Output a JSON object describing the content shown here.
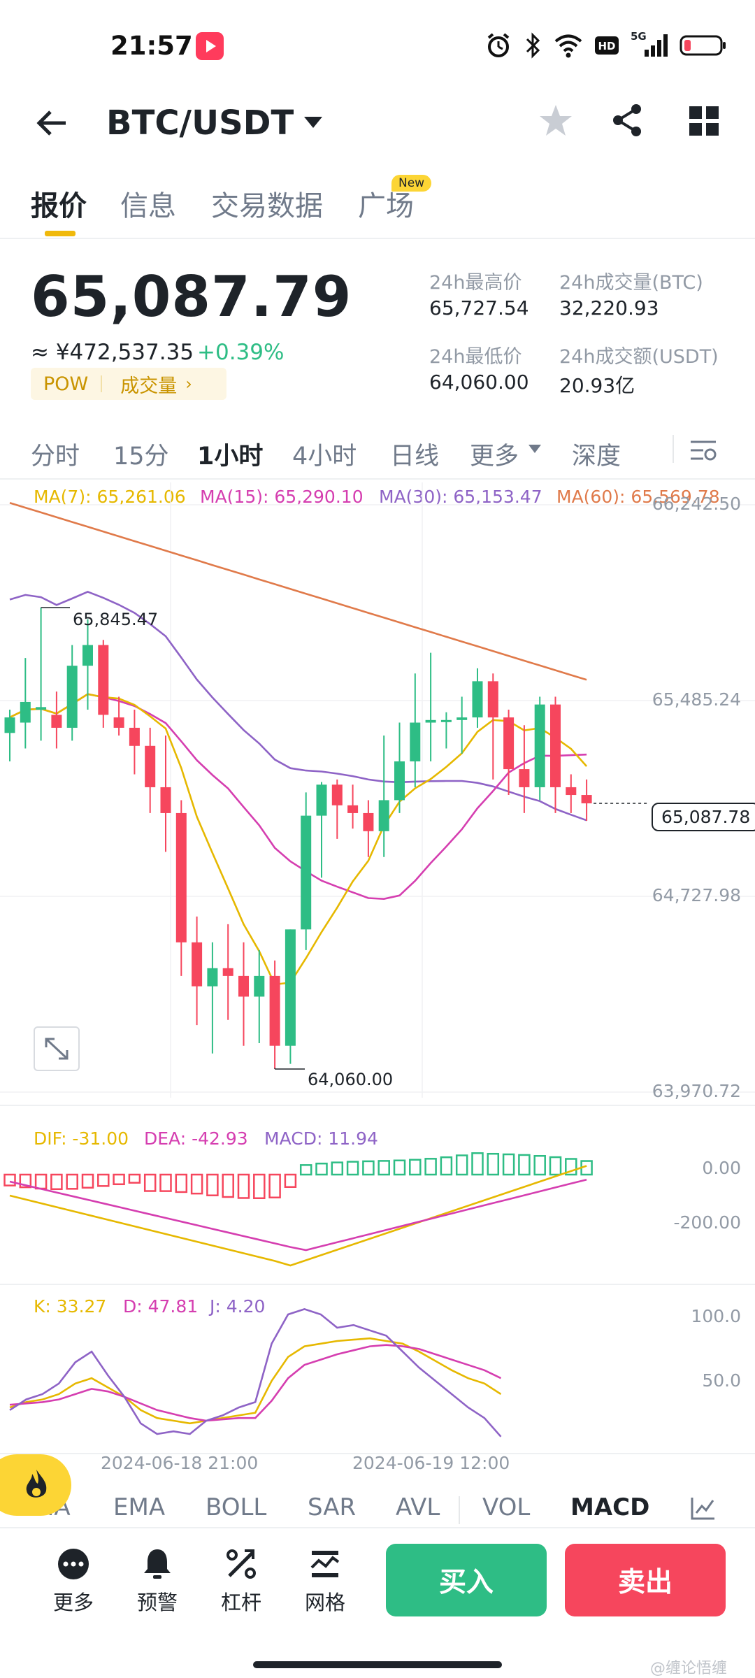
{
  "status_bar": {
    "time": "21:57",
    "network": "5G"
  },
  "header": {
    "pair": "BTC/USDT"
  },
  "tabs": [
    {
      "label": "报价"
    },
    {
      "label": "信息"
    },
    {
      "label": "交易数据"
    },
    {
      "label": "广场",
      "badge": "New"
    }
  ],
  "price": {
    "last": "65,087.79",
    "cny": "≈ ¥472,537.35",
    "change": "+0.39%",
    "tag_pow": "POW",
    "tag_volume": "成交量"
  },
  "stats": {
    "high_label": "24h最高价",
    "high": "65,727.54",
    "low_label": "24h最低价",
    "low": "64,060.00",
    "vol_btc_label": "24h成交量(BTC)",
    "vol_btc": "32,220.93",
    "vol_usdt_label": "24h成交额(USDT)",
    "vol_usdt": "20.93亿"
  },
  "intervals": [
    "分时",
    "15分",
    "1小时",
    "4小时",
    "日线",
    "更多",
    "深度"
  ],
  "ma": {
    "ma7": "MA(7): 65,261.06",
    "ma15": "MA(15): 65,290.10",
    "ma30": "MA(30): 65,153.47",
    "ma60": "MA(60): 65,569.78"
  },
  "price_axis": [
    "66,242.50",
    "65,485.24",
    "64,727.98",
    "63,970.72"
  ],
  "current_price_label": "65,087.78",
  "high_marker": "65,845.47",
  "low_marker": "64,060.00",
  "macd": {
    "dif": "DIF: -31.00",
    "dea": "DEA: -42.93",
    "macd": "MACD: 11.94",
    "axis": [
      "0.00",
      "-200.00"
    ]
  },
  "kdj": {
    "k": "K: 33.27",
    "d": "D: 47.81",
    "j": "J: 4.20",
    "axis": [
      "100.0",
      "50.0"
    ]
  },
  "time_axis": [
    "2024-06-18 21:00",
    "2024-06-19 12:00"
  ],
  "indicators": [
    "MA",
    "EMA",
    "BOLL",
    "SAR",
    "AVL",
    "VOL",
    "MACD"
  ],
  "bottom_bar": {
    "more": "更多",
    "alert": "预警",
    "leverage": "杠杆",
    "grid": "网格",
    "buy": "买入",
    "sell": "卖出"
  },
  "watermark": "@缠论悟缠",
  "colors": {
    "up": "#2ebd85",
    "down": "#f6465d",
    "accent": "#f0b90b",
    "ma7": "#e6b800",
    "ma15": "#d53eb0",
    "ma30": "#8e63c6",
    "ma60": "#e07a4a"
  },
  "chart_data": {
    "type": "candlestick",
    "candles": [
      {
        "o": 65360,
        "h": 65450,
        "l": 65250,
        "c": 65420
      },
      {
        "o": 65400,
        "h": 65650,
        "l": 65300,
        "c": 65480
      },
      {
        "o": 65450,
        "h": 65845,
        "l": 65330,
        "c": 65460
      },
      {
        "o": 65430,
        "h": 65520,
        "l": 65300,
        "c": 65380
      },
      {
        "o": 65380,
        "h": 65700,
        "l": 65330,
        "c": 65620
      },
      {
        "o": 65620,
        "h": 65800,
        "l": 65450,
        "c": 65700
      },
      {
        "o": 65700,
        "h": 65720,
        "l": 65380,
        "c": 65430
      },
      {
        "o": 65420,
        "h": 65500,
        "l": 65350,
        "c": 65380
      },
      {
        "o": 65380,
        "h": 65450,
        "l": 65200,
        "c": 65310
      },
      {
        "o": 65310,
        "h": 65380,
        "l": 65050,
        "c": 65150
      },
      {
        "o": 65150,
        "h": 65350,
        "l": 64900,
        "c": 65050
      },
      {
        "o": 65050,
        "h": 65100,
        "l": 64420,
        "c": 64550
      },
      {
        "o": 64550,
        "h": 64650,
        "l": 64230,
        "c": 64380
      },
      {
        "o": 64380,
        "h": 64550,
        "l": 64120,
        "c": 64450
      },
      {
        "o": 64450,
        "h": 64620,
        "l": 64250,
        "c": 64420
      },
      {
        "o": 64420,
        "h": 64550,
        "l": 64150,
        "c": 64340
      },
      {
        "o": 64340,
        "h": 64520,
        "l": 64160,
        "c": 64420
      },
      {
        "o": 64420,
        "h": 64480,
        "l": 64060,
        "c": 64150
      },
      {
        "o": 64150,
        "h": 64600,
        "l": 64080,
        "c": 64600
      },
      {
        "o": 64600,
        "h": 65130,
        "l": 64520,
        "c": 65040
      },
      {
        "o": 65040,
        "h": 65170,
        "l": 64800,
        "c": 65160
      },
      {
        "o": 65160,
        "h": 65180,
        "l": 64950,
        "c": 65080
      },
      {
        "o": 65080,
        "h": 65160,
        "l": 64990,
        "c": 65050
      },
      {
        "o": 65050,
        "h": 65100,
        "l": 64880,
        "c": 64980
      },
      {
        "o": 64980,
        "h": 65350,
        "l": 64880,
        "c": 65100
      },
      {
        "o": 65100,
        "h": 65400,
        "l": 65050,
        "c": 65250
      },
      {
        "o": 65250,
        "h": 65590,
        "l": 65150,
        "c": 65400
      },
      {
        "o": 65400,
        "h": 65670,
        "l": 65250,
        "c": 65410
      },
      {
        "o": 65410,
        "h": 65440,
        "l": 65300,
        "c": 65410
      },
      {
        "o": 65410,
        "h": 65500,
        "l": 65280,
        "c": 65420
      },
      {
        "o": 65420,
        "h": 65610,
        "l": 65380,
        "c": 65560
      },
      {
        "o": 65560,
        "h": 65590,
        "l": 65180,
        "c": 65420
      },
      {
        "o": 65420,
        "h": 65450,
        "l": 65120,
        "c": 65220
      },
      {
        "o": 65220,
        "h": 65390,
        "l": 65050,
        "c": 65150
      },
      {
        "o": 65150,
        "h": 65500,
        "l": 65100,
        "c": 65470
      },
      {
        "o": 65470,
        "h": 65500,
        "l": 65050,
        "c": 65150
      },
      {
        "o": 65150,
        "h": 65200,
        "l": 65050,
        "c": 65120
      },
      {
        "o": 65120,
        "h": 65180,
        "l": 65020,
        "c": 65087.79
      }
    ],
    "ylim": [
      63970.72,
      66242.5
    ]
  }
}
